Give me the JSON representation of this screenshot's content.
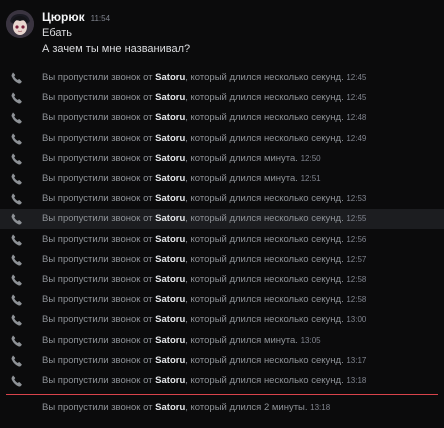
{
  "message_group": {
    "author": "Цюрюк",
    "time": "11:54",
    "lines": [
      "Ебать",
      "А зачем ты мне названивал?"
    ]
  },
  "call_prefix": "Вы пропустили звонок от ",
  "calls": [
    {
      "user": "Satoru",
      "suffix": ", который длился несколько секунд.",
      "time": "12:45"
    },
    {
      "user": "Satoru",
      "suffix": ", который длился несколько секунд.",
      "time": "12:45"
    },
    {
      "user": "Satoru",
      "suffix": ", который длился несколько секунд.",
      "time": "12:48"
    },
    {
      "user": "Satoru",
      "suffix": ", который длился несколько секунд.",
      "time": "12:49"
    },
    {
      "user": "Satoru",
      "suffix": ", который длился минута.",
      "time": "12:50"
    },
    {
      "user": "Satoru",
      "suffix": ", который длился минута.",
      "time": "12:51"
    },
    {
      "user": "Satoru",
      "suffix": ", который длился несколько секунд.",
      "time": "12:53"
    },
    {
      "user": "Satoru",
      "suffix": ", который длился несколько секунд.",
      "time": "12:55"
    },
    {
      "user": "Satoru",
      "suffix": ", который длился несколько секунд.",
      "time": "12:56"
    },
    {
      "user": "Satoru",
      "suffix": ", который длился несколько секунд.",
      "time": "12:57"
    },
    {
      "user": "Satoru",
      "suffix": ", который длился несколько секунд.",
      "time": "12:58"
    },
    {
      "user": "Satoru",
      "suffix": ", который длился несколько секунд.",
      "time": "12:58"
    },
    {
      "user": "Satoru",
      "suffix": ", который длился несколько секунд.",
      "time": "13:00"
    },
    {
      "user": "Satoru",
      "suffix": ", который длился минута.",
      "time": "13:05"
    },
    {
      "user": "Satoru",
      "suffix": ", который длился несколько секунд.",
      "time": "13:17"
    },
    {
      "user": "Satoru",
      "suffix": ", который длился несколько секунд.",
      "time": "13:18"
    }
  ],
  "last_call": {
    "user": "Satoru",
    "suffix": ", который длился 2 минуты.",
    "time": "13:18"
  },
  "colors": {
    "background": "#0b0b0c",
    "hover_row": "#1c1d20",
    "new_messages_divider": "#d8434b",
    "muted_text": "#8e9297"
  }
}
